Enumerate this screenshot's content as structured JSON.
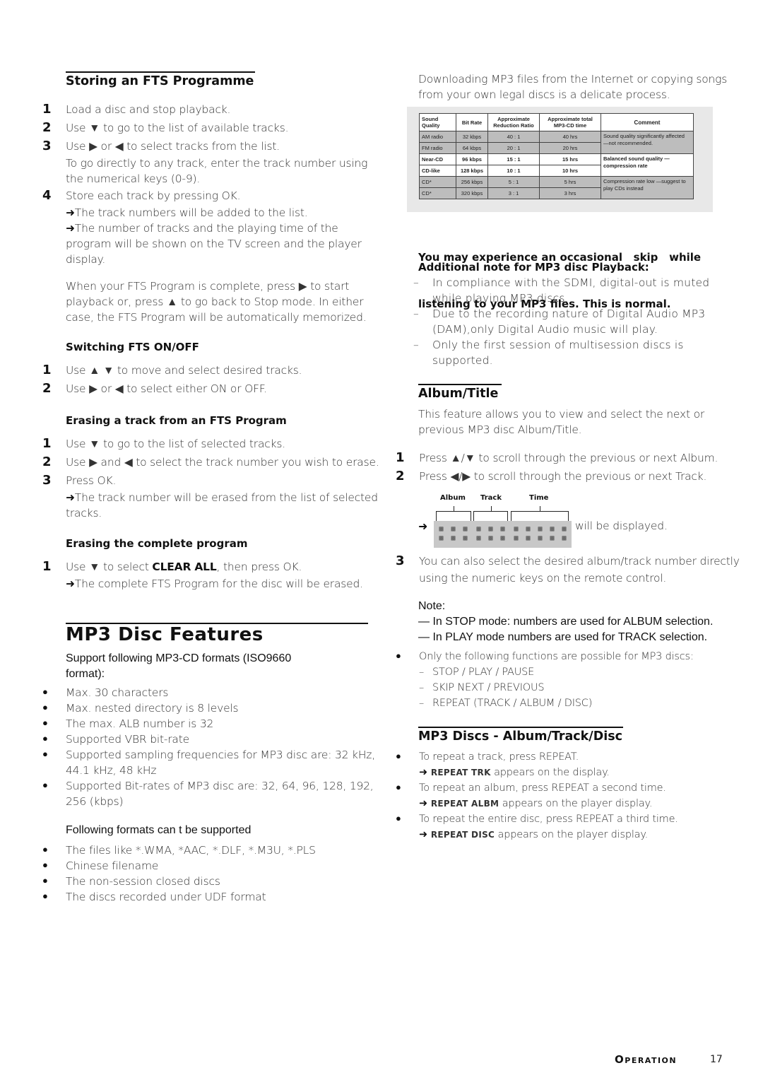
{
  "left": {
    "storing": {
      "title": "Storing an FTS Programme",
      "steps": [
        {
          "n": "1",
          "text": "Load a disc and stop playback."
        },
        {
          "n": "2",
          "text": "Use ▼ to go to the list of available tracks."
        },
        {
          "n": "3",
          "text": "Use ▶ or ◀ to select tracks from the list."
        },
        {
          "n": "4",
          "text": "Store each track by pressing OK."
        }
      ],
      "step3_extra_1": "To go directly to any track, enter the track number using",
      "step3_extra_2": "the numerical keys (0-9).",
      "result_1": "The track numbers will be added to the list.",
      "result_2_l1": "The number of tracks and the playing time of the",
      "result_2_l2": "program will be shown on the TV screen and the player",
      "result_2_l3": "display.",
      "para_l1": "When your FTS Program is complete, press ▶ to start",
      "para_l2": "playback or, press ▲ to go back to Stop mode. In either",
      "para_l3": "case, the FTS Program will be automatically memorized."
    },
    "switching": {
      "title": "Switching FTS ON/OFF",
      "steps": [
        {
          "n": "1",
          "text": "Use ▲ ▼ to move and select desired tracks."
        },
        {
          "n": "2",
          "text": "Use ▶ or ◀ to select either ON or OFF."
        }
      ]
    },
    "erasing_track": {
      "title": "Erasing a track from an FTS Program",
      "steps": [
        {
          "n": "1",
          "text": "Use ▼ to go to the list of selected tracks."
        },
        {
          "n": "2",
          "text": "Use ▶ and ◀ to select the track number you wish to erase."
        },
        {
          "n": "3",
          "text": "Press OK."
        }
      ],
      "result_l1": "The track number will be erased from the list of selected",
      "result_l2": "tracks."
    },
    "erasing_all": {
      "title": "Erasing the complete program",
      "step_n": "1",
      "step_pre": "Use ▼ to select ",
      "step_bold": "CLEAR ALL",
      "step_post": ", then press OK.",
      "result": "The complete FTS Program for the disc will be erased."
    },
    "mp3": {
      "title": "MP3 Disc Features",
      "support_l1": "Support following MP3-CD formats (ISO9660",
      "support_l2": "format):",
      "supported": [
        "Max. 30 characters",
        "Max. nested directory is 8 levels",
        "The max. ALB number is 32",
        "Supported VBR bit-rate"
      ],
      "sampling_l1": "Supported sampling frequencies for MP3 disc are: 32 kHz,",
      "sampling_l2": "44.1 kHz, 48 kHz",
      "bitrates_l1": "Supported Bit-rates of MP3 disc are: 32, 64, 96, 128, 192,",
      "bitrates_l2": "256 (kbps)",
      "unsupported_title": "Following formats can t be supported",
      "unsupported": [
        "The files like *.WMA, *AAC, *.DLF, *.M3U, *.PLS",
        "Chinese filename",
        "The non-session closed discs",
        "The discs recorded under UDF format"
      ]
    }
  },
  "right": {
    "intro_l1": "Downloading MP3 files from the Internet or copying songs",
    "intro_l2": "from your own legal discs is a delicate process.",
    "table": {
      "headers": [
        "Sound Quality",
        "Bit Rate",
        "Approximate Reduction Ratio",
        "Approximate total MP3-CD time",
        "Comment"
      ],
      "rows": [
        [
          "AM radio",
          "32 kbps",
          "40 : 1",
          "40 hrs"
        ],
        [
          "FM radio",
          "64 kbps",
          "20 : 1",
          "20 hrs"
        ],
        [
          "Near-CD",
          "96 kbps",
          "15 : 1",
          "15 hrs"
        ],
        [
          "CD-like",
          "128 kbps",
          "10 : 1",
          "10 hrs"
        ],
        [
          "CD*",
          "256 kbps",
          "5 : 1",
          "5 hrs"
        ],
        [
          "CD*",
          "320 kbps",
          "3 : 1",
          "3 hrs"
        ]
      ],
      "comments": [
        "Sound quality significantly affected —not recommended.",
        "Balanced sound quality —compression rate",
        "Compression rate low —suggest to play CDs instead"
      ]
    },
    "skip_l1": "You may experience an occasional   skip   while",
    "skip_l2": "listening to your MP3 files. This is normal.",
    "note_title": "Additional note for MP3 disc Playback:",
    "notes": [
      {
        "l1": "In compliance with the SDMI, digital-out is muted",
        "l2": "while playing MP3 discs."
      },
      {
        "l1": "Due to the recording nature of Digital Audio MP3",
        "l2": "(DAM),only Digital Audio music will play."
      },
      {
        "l1": "Only the first session of multisession discs is",
        "l2": "supported."
      }
    ],
    "album": {
      "title": "Album/Title",
      "desc_l1": "This feature allows you to view and select the next or",
      "desc_l2": "previous MP3 disc Album/Title.",
      "steps": [
        {
          "n": "1",
          "text": "Press ▲/▼ to scroll through the previous or next Album."
        },
        {
          "n": "2",
          "text": "Press ◀/▶ to scroll through the previous or next Track."
        }
      ],
      "display_labels": [
        "Album",
        "Track",
        "Time"
      ],
      "display_suffix": "will be displayed.",
      "step3_n": "3",
      "step3_l1": "You can also select the desired album/track number directly",
      "step3_l2": "using the numeric keys on the remote control.",
      "note_label": "Note:",
      "note_1": "— In STOP mode: numbers are used for ALBUM selection.",
      "note_2": "— In PLAY mode numbers are used for TRACK selection.",
      "functions_intro": "Only the following functions are possible for MP3 discs:",
      "functions": [
        "STOP / PLAY / PAUSE",
        "SKIP NEXT / PREVIOUS",
        "REPEAT (TRACK / ALBUM / DISC)"
      ]
    },
    "repeat": {
      "title": "MP3 Discs - Album/Track/Disc",
      "items": [
        {
          "text": "To repeat a track, press REPEAT.",
          "code": "REPEAT TRK",
          "result": " appears on the display."
        },
        {
          "text": "To repeat an album, press REPEAT a second time.",
          "code": "REPEAT ALBM",
          "result": " appears on the player display."
        },
        {
          "text": "To repeat the entire disc, press REPEAT a third time.",
          "code": "REPEAT DISC",
          "result": " appears on the player display."
        }
      ]
    }
  },
  "footer": {
    "section": "Operation",
    "page": "17"
  }
}
